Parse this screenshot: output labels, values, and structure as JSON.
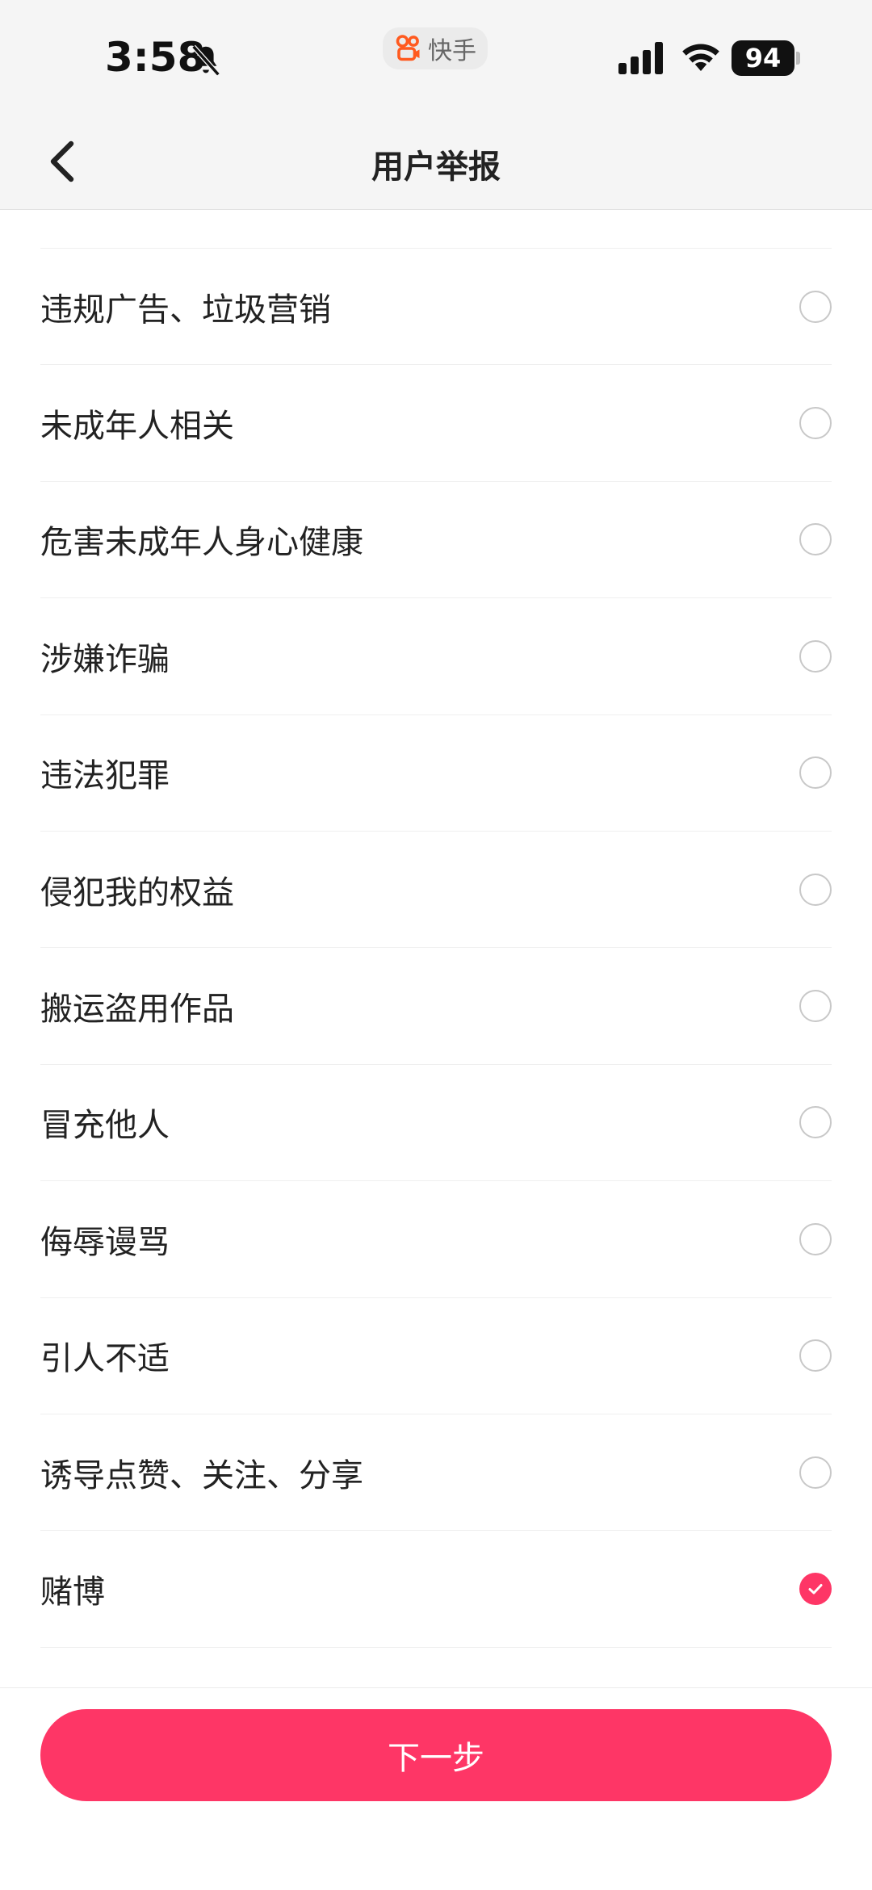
{
  "status_bar": {
    "time": "3:58",
    "app_name": "快手",
    "battery": "94",
    "icons": [
      "bell-muted-icon",
      "kuaishou-logo-icon",
      "cellular-signal-icon",
      "wifi-icon",
      "battery-icon"
    ]
  },
  "nav": {
    "title": "用户举报",
    "back_icon": "chevron-left-icon"
  },
  "options": [
    {
      "label": "违规广告、垃圾营销",
      "selected": false
    },
    {
      "label": "未成年人相关",
      "selected": false
    },
    {
      "label": "危害未成年人身心健康",
      "selected": false
    },
    {
      "label": "涉嫌诈骗",
      "selected": false
    },
    {
      "label": "违法犯罪",
      "selected": false
    },
    {
      "label": "侵犯我的权益",
      "selected": false
    },
    {
      "label": "搬运盗用作品",
      "selected": false
    },
    {
      "label": "冒充他人",
      "selected": false
    },
    {
      "label": "侮辱谩骂",
      "selected": false
    },
    {
      "label": "引人不适",
      "selected": false
    },
    {
      "label": "诱导点赞、关注、分享",
      "selected": false
    },
    {
      "label": "赌博",
      "selected": true
    }
  ],
  "footer": {
    "next_label": "下一步"
  },
  "colors": {
    "accent": "#fe3666",
    "background": "#ffffff",
    "header_bg": "#f5f5f5",
    "radio_border": "#c8c8c8",
    "text": "#222222"
  }
}
